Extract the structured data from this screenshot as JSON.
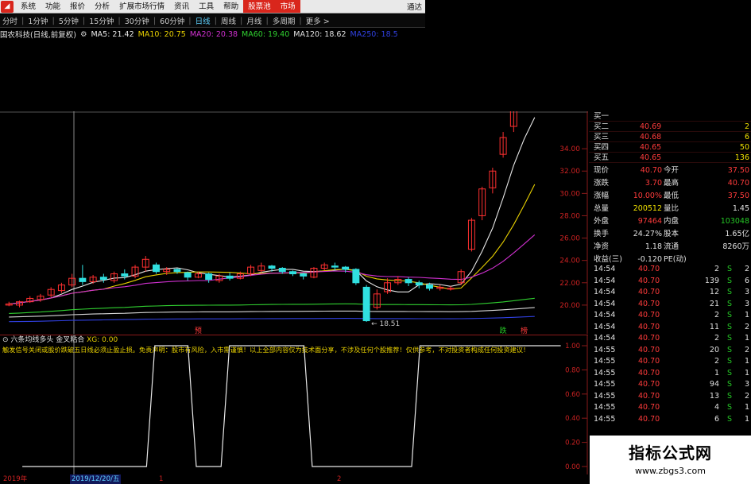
{
  "menu": {
    "items": [
      "系统",
      "功能",
      "报价",
      "分析",
      "扩展市场行情",
      "资讯",
      "工具",
      "帮助"
    ],
    "highlight_items": [
      "股票池",
      "市场"
    ],
    "right_text": "通达"
  },
  "periods": {
    "items": [
      "分时",
      "1分钟",
      "5分钟",
      "15分钟",
      "30分钟",
      "60分钟",
      "日线",
      "周线",
      "月线",
      "多周期",
      "更多 >"
    ],
    "active": "日线"
  },
  "ma_bar": {
    "stock": "国农科技(日线,前复权)",
    "items": [
      {
        "label": "MA5: 21.42",
        "color": "#e8e8e8"
      },
      {
        "label": "MA10: 20.75",
        "color": "#e8d000"
      },
      {
        "label": "MA20: 20.38",
        "color": "#d030d0"
      },
      {
        "label": "MA60: 19.40",
        "color": "#30d030"
      },
      {
        "label": "MA120: 18.62",
        "color": "#e0e0e0"
      },
      {
        "label": "MA250: 18.5",
        "color": "#3040e0"
      }
    ]
  },
  "price_axis": [
    "34.00",
    "32.00",
    "30.00",
    "28.00",
    "26.00",
    "24.00",
    "22.00",
    "20.00"
  ],
  "chart_data": {
    "type": "candlestick",
    "candles": [
      [
        20.0,
        20.1,
        19.9,
        20.3
      ],
      [
        20.0,
        20.3,
        19.8,
        20.4
      ],
      [
        20.3,
        20.6,
        20.2,
        20.8
      ],
      [
        20.5,
        20.8,
        20.3,
        21.0
      ],
      [
        20.9,
        21.4,
        20.7,
        21.6
      ],
      [
        21.3,
        21.8,
        21.1,
        22.0
      ],
      [
        21.8,
        22.4,
        21.6,
        22.8
      ],
      [
        22.4,
        22.1,
        21.8,
        23.6
      ],
      [
        22.1,
        22.5,
        21.9,
        22.7
      ],
      [
        22.5,
        22.3,
        22.0,
        22.8
      ],
      [
        22.2,
        22.8,
        22.0,
        23.0
      ],
      [
        22.8,
        22.6,
        22.3,
        23.2
      ],
      [
        22.6,
        23.4,
        22.4,
        23.6
      ],
      [
        23.4,
        24.1,
        23.0,
        24.4
      ],
      [
        23.6,
        23.0,
        22.8,
        23.8
      ],
      [
        23.0,
        23.2,
        22.7,
        23.4
      ],
      [
        23.2,
        23.0,
        22.8,
        23.3
      ],
      [
        22.9,
        22.5,
        22.2,
        23.0
      ],
      [
        22.5,
        22.8,
        22.4,
        23.0
      ],
      [
        22.8,
        22.3,
        22.0,
        22.9
      ],
      [
        22.2,
        22.6,
        22.0,
        22.8
      ],
      [
        22.6,
        22.4,
        22.2,
        22.9
      ],
      [
        22.4,
        22.8,
        22.3,
        23.0
      ],
      [
        22.8,
        23.4,
        22.6,
        23.6
      ],
      [
        23.1,
        23.5,
        22.9,
        23.8
      ],
      [
        23.5,
        23.3,
        23.0,
        23.6
      ],
      [
        23.3,
        23.0,
        22.8,
        23.4
      ],
      [
        23.0,
        22.8,
        22.6,
        23.1
      ],
      [
        22.8,
        22.6,
        22.3,
        22.9
      ],
      [
        22.5,
        23.3,
        22.4,
        23.4
      ],
      [
        23.3,
        23.6,
        23.1,
        23.8
      ],
      [
        23.5,
        23.4,
        23.1,
        23.8
      ],
      [
        23.4,
        23.2,
        22.9,
        23.5
      ],
      [
        23.2,
        22.0,
        21.8,
        23.3
      ],
      [
        21.6,
        18.6,
        18.5,
        21.8
      ],
      [
        19.8,
        21.0,
        19.6,
        21.4
      ],
      [
        21.2,
        22.0,
        21.0,
        22.4
      ],
      [
        22.0,
        22.3,
        21.8,
        22.6
      ],
      [
        22.3,
        22.0,
        21.7,
        22.5
      ],
      [
        22.0,
        21.8,
        21.5,
        22.2
      ],
      [
        21.8,
        21.5,
        21.3,
        22.0
      ],
      [
        21.5,
        21.6,
        21.3,
        21.8
      ],
      [
        21.5,
        21.5,
        21.3,
        21.7
      ],
      [
        22.0,
        23.0,
        21.8,
        23.2
      ],
      [
        25.0,
        27.6,
        24.8,
        27.8
      ],
      [
        28.0,
        30.4,
        27.6,
        30.6
      ],
      [
        30.5,
        32.0,
        30.0,
        32.3
      ],
      [
        33.5,
        35.0,
        33.2,
        35.5
      ],
      [
        36.0,
        37.5,
        35.5,
        38.0
      ],
      [
        38.0,
        39.5,
        37.5,
        40.7
      ],
      [
        39.0,
        40.0,
        38.0,
        41.2
      ]
    ],
    "price_range": [
      18.0,
      36.5
    ],
    "low_annotation": "18.51",
    "indicator": {
      "name": "六条均线多头",
      "signal_label": "金叉粘合",
      "signal_value": "XG: 0.00",
      "axis": [
        "1.00",
        "0.80",
        "0.60",
        "0.40",
        "0.20",
        "0.00"
      ],
      "values": [
        0,
        0,
        0,
        0,
        0,
        0,
        0,
        0,
        0,
        0,
        0,
        0,
        0,
        0,
        0,
        0,
        1,
        1,
        1,
        1,
        1,
        0,
        0,
        0,
        0,
        1,
        1,
        1,
        1,
        1,
        1,
        1,
        1,
        1,
        1,
        0,
        0,
        0,
        0,
        0,
        0,
        0,
        0,
        0,
        0,
        0,
        0,
        0,
        1,
        1,
        1,
        1,
        1,
        1,
        1,
        1,
        1,
        1,
        1,
        1,
        1,
        1,
        1,
        1,
        1,
        1
      ],
      "warning": "触发信号关闭或股价跌破五日线必须止盈止损。免责声明：股市有风险，入市需谨慎！以上全部内容仅为技术面分享，不涉及任何个股推荐！仅供参考，不对投资者构成任何投资建议！"
    },
    "markers": [
      {
        "text": "预",
        "color": "#ff3b3b",
        "at": 18
      },
      {
        "text": "跌",
        "color": "#25c725",
        "at": 47
      },
      {
        "text": "榜",
        "color": "#ff3b3b",
        "at": 49
      }
    ],
    "time_axis": [
      {
        "text": "2019年",
        "color": "#cc2222"
      },
      {
        "text": "2019/12/20/五",
        "color": "#5fd2ff"
      },
      {
        "text": "1",
        "color": "#cc2222"
      },
      {
        "text": "2",
        "color": "#cc2222"
      }
    ]
  },
  "quotes": {
    "bids": [
      {
        "label": "买一",
        "price": "",
        "vol": ""
      },
      {
        "label": "买二",
        "price": "40.69",
        "vol": "2"
      },
      {
        "label": "买三",
        "price": "40.68",
        "vol": "6"
      },
      {
        "label": "买四",
        "price": "40.65",
        "vol": "50"
      },
      {
        "label": "买五",
        "price": "40.65",
        "vol": "136"
      }
    ],
    "stats": [
      {
        "l1": "现价",
        "v1": "40.70",
        "l2": "今开",
        "v2": "37.50"
      },
      {
        "l1": "涨跌",
        "v1": "3.70",
        "l2": "最高",
        "v2": "40.70"
      },
      {
        "l1": "涨幅",
        "v1": "10.00%",
        "l2": "最低",
        "v2": "37.50"
      },
      {
        "l1": "总量",
        "v1": "200512",
        "l2": "量比",
        "v2": "1.45"
      },
      {
        "l1": "外盘",
        "v1": "97464",
        "l2": "内盘",
        "v2": "103048"
      },
      {
        "l1": "换手",
        "v1": "24.27%",
        "l2": "股本",
        "v2": "1.65亿"
      },
      {
        "l1": "净资",
        "v1": "1.18",
        "l2": "流通",
        "v2": "8260万"
      },
      {
        "l1": "收益(三)",
        "v1": "-0.120",
        "l2": "PE(动)",
        "v2": ""
      }
    ],
    "ticks": [
      {
        "t": "14:54",
        "p": "40.70",
        "v": "2",
        "d": "S",
        "n": "2"
      },
      {
        "t": "14:54",
        "p": "40.70",
        "v": "139",
        "d": "S",
        "n": "6"
      },
      {
        "t": "14:54",
        "p": "40.70",
        "v": "12",
        "d": "S",
        "n": "3"
      },
      {
        "t": "14:54",
        "p": "40.70",
        "v": "21",
        "d": "S",
        "n": "3"
      },
      {
        "t": "14:54",
        "p": "40.70",
        "v": "2",
        "d": "S",
        "n": "1"
      },
      {
        "t": "14:54",
        "p": "40.70",
        "v": "11",
        "d": "S",
        "n": "2"
      },
      {
        "t": "14:54",
        "p": "40.70",
        "v": "2",
        "d": "S",
        "n": "1"
      },
      {
        "t": "14:55",
        "p": "40.70",
        "v": "20",
        "d": "S",
        "n": "2"
      },
      {
        "t": "14:55",
        "p": "40.70",
        "v": "2",
        "d": "S",
        "n": "1"
      },
      {
        "t": "14:55",
        "p": "40.70",
        "v": "1",
        "d": "S",
        "n": "1"
      },
      {
        "t": "14:55",
        "p": "40.70",
        "v": "94",
        "d": "S",
        "n": "3"
      },
      {
        "t": "14:55",
        "p": "40.70",
        "v": "13",
        "d": "S",
        "n": "2"
      },
      {
        "t": "14:55",
        "p": "40.70",
        "v": "4",
        "d": "S",
        "n": "1"
      },
      {
        "t": "14:55",
        "p": "40.70",
        "v": "6",
        "d": "S",
        "n": "1"
      }
    ]
  },
  "watermark": {
    "line1": "指标公式网",
    "line2": "www.zbgs3.com"
  }
}
